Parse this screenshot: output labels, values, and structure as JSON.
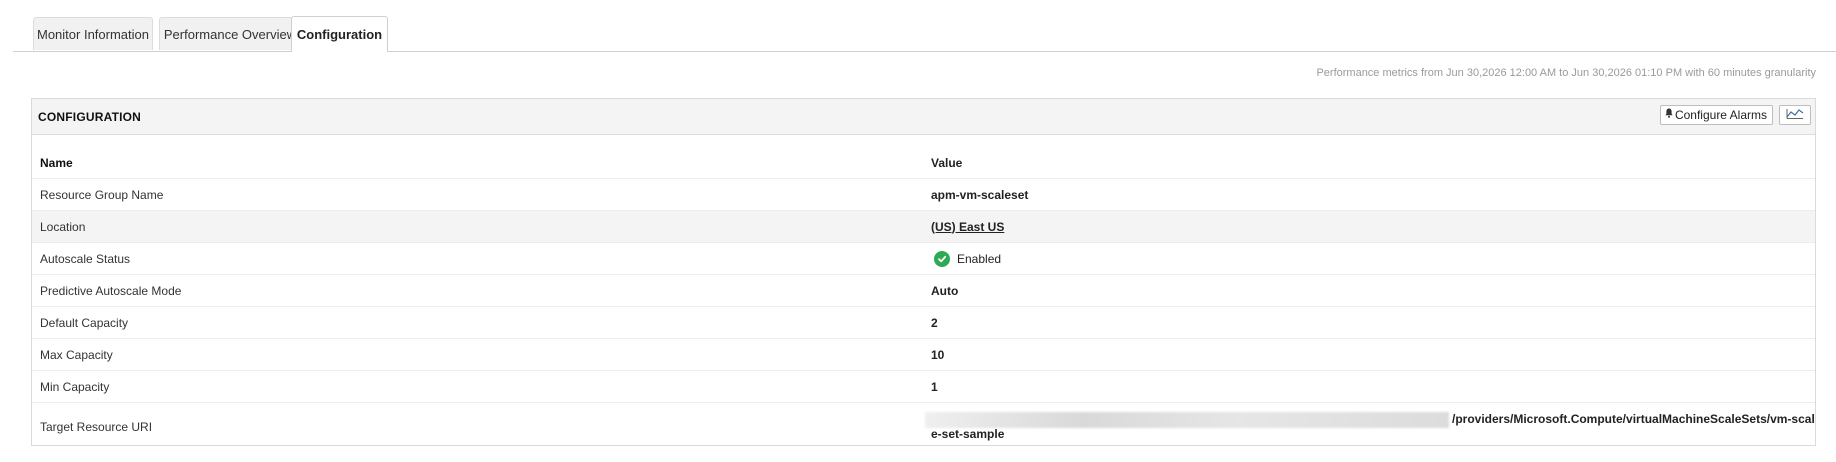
{
  "tabs": [
    {
      "label": "Monitor Information"
    },
    {
      "label": "Performance Overview"
    },
    {
      "label": "Configuration"
    }
  ],
  "perf_text": "Performance metrics from Jun 30,2026 12:00 AM to Jun 30,2026 01:10 PM with 60 minutes granularity",
  "panel": {
    "title": "CONFIGURATION",
    "configure_alarms_label": "Configure Alarms"
  },
  "table": {
    "headers": {
      "name": "Name",
      "value": "Value"
    },
    "rows": [
      {
        "name": "Resource Group Name",
        "value": "apm-vm-scaleset"
      },
      {
        "name": "Location",
        "value": "(US) East US"
      },
      {
        "name": "Autoscale Status",
        "value": "Enabled"
      },
      {
        "name": "Predictive Autoscale Mode",
        "value": "Auto"
      },
      {
        "name": "Default Capacity",
        "value": "2"
      },
      {
        "name": "Max Capacity",
        "value": "10"
      },
      {
        "name": "Min Capacity",
        "value": "1"
      },
      {
        "name": "Target Resource URI",
        "value_line1": "/providers/Microsoft.Compute/virtualMachineScaleSets/vm-scal",
        "value_line2": "e-set-sample"
      }
    ]
  },
  "colors": {
    "enabled_status": "#2eaa57"
  },
  "icons": {
    "alarm": "bell-icon",
    "status": "check-circle-icon",
    "chart": "chart-icon"
  }
}
